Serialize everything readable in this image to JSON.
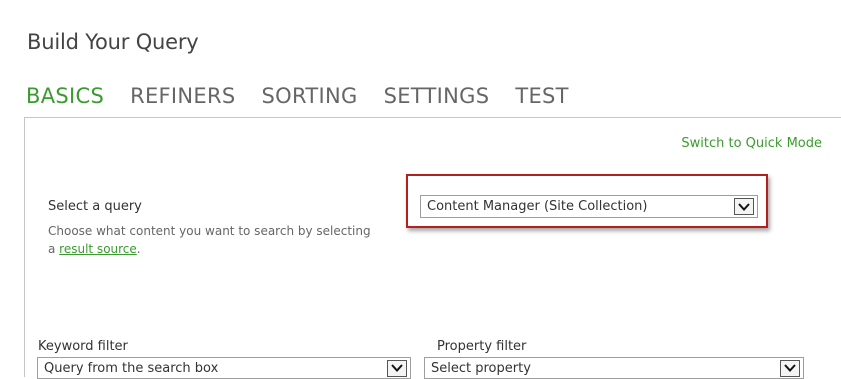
{
  "page": {
    "title": "Build Your Query"
  },
  "tabs": [
    {
      "label": "BASICS",
      "active": true
    },
    {
      "label": "REFINERS",
      "active": false
    },
    {
      "label": "SORTING",
      "active": false
    },
    {
      "label": "SETTINGS",
      "active": false
    },
    {
      "label": "TEST",
      "active": false
    }
  ],
  "quick_mode_link": "Switch to Quick Mode",
  "query": {
    "label": "Select a query",
    "description_prefix": "Choose what content you want to search by selecting a ",
    "description_link": "result source",
    "description_suffix": ".",
    "selected": "Content Manager (Site Collection)",
    "arrow_icon": "chevron-down-icon"
  },
  "keyword_filter": {
    "label": "Keyword filter",
    "selected": "Query from the search box"
  },
  "property_filter": {
    "label": "Property filter",
    "selected": "Select property"
  },
  "colors": {
    "accent": "#3a9b2e",
    "highlight_border": "#b22020",
    "text": "#444444"
  }
}
